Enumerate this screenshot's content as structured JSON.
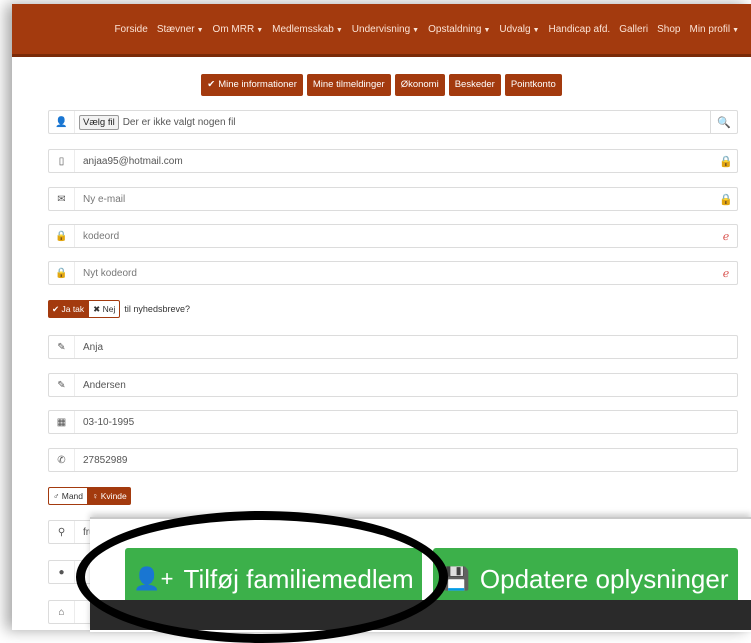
{
  "nav": {
    "items": [
      {
        "label": "Forside",
        "caret": false
      },
      {
        "label": "Stævner",
        "caret": true
      },
      {
        "label": "Om MRR",
        "caret": true
      },
      {
        "label": "Medlemsskab",
        "caret": true
      },
      {
        "label": "Undervisning",
        "caret": true
      },
      {
        "label": "Opstaldning",
        "caret": true
      },
      {
        "label": "Udvalg",
        "caret": true
      },
      {
        "label": "Handicap afd.",
        "caret": false
      },
      {
        "label": "Galleri",
        "caret": false
      },
      {
        "label": "Shop",
        "caret": false
      },
      {
        "label": "Min profil",
        "caret": true
      }
    ]
  },
  "tabs": {
    "mine_informationer": "Mine informationer",
    "mine_tilmeldinger": "Mine tilmeldinger",
    "okonomi": "Økonomi",
    "beskeder": "Beskeder",
    "pointkonto": "Pointkonto"
  },
  "form": {
    "file_button": "Vælg fil",
    "file_status": "Der er ikke valgt nogen fil",
    "email": "anjaa95@hotmail.com",
    "new_email_placeholder": "Ny e-mail",
    "password_placeholder": "kodeord",
    "new_password_placeholder": "Nyt kodeord",
    "newsletter_yes": "Ja tak",
    "newsletter_no": "Nej",
    "newsletter_label": "til nyhedsbreve?",
    "first_name": "Anja",
    "last_name": "Andersen",
    "birthdate": "03-10-1995",
    "phone": "27852989",
    "gender_male": "Mand",
    "gender_female": "Kvinde",
    "partial_address": "fru"
  },
  "actions": {
    "add_family": "Tilføj familiemedlem",
    "update_info": "Opdatere oplysninger"
  },
  "colors": {
    "brand": "#a33a0e",
    "action_green": "#3cb04a"
  }
}
